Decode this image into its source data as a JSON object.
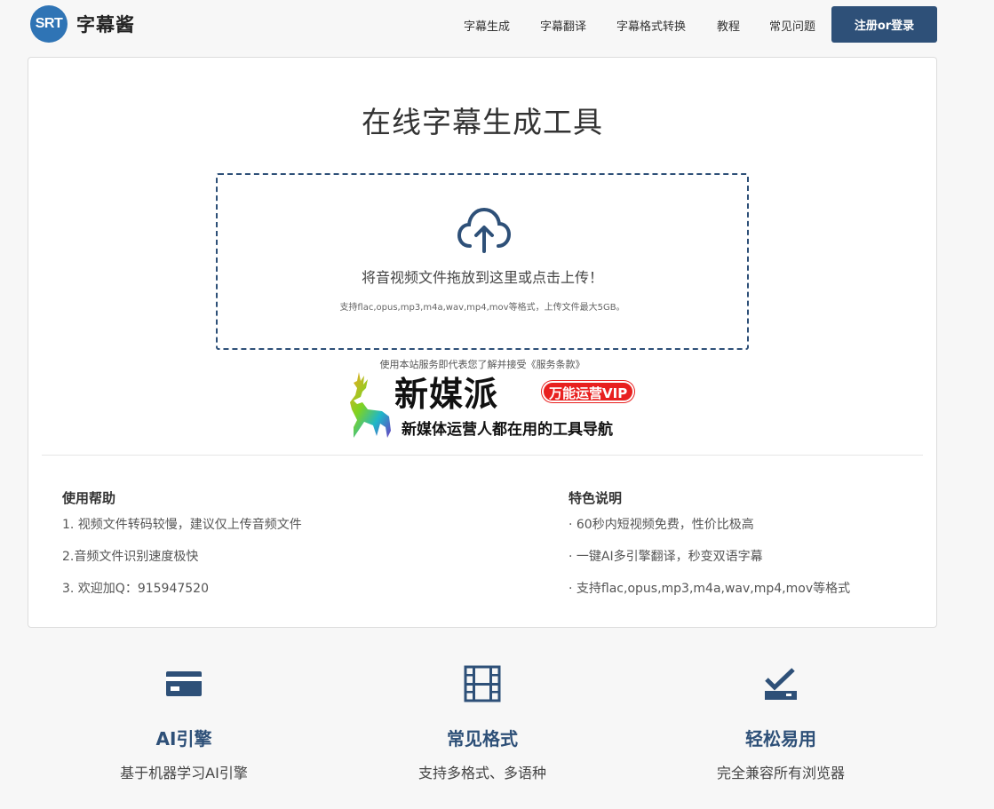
{
  "header": {
    "logo_badge": "SRT",
    "logo_name": "字幕酱",
    "nav": [
      {
        "label": "字幕生成"
      },
      {
        "label": "字幕翻译"
      },
      {
        "label": "字幕格式转换"
      },
      {
        "label": "教程"
      },
      {
        "label": "常见问题"
      }
    ],
    "login_label": "注册or登录"
  },
  "main": {
    "title": "在线字幕生成工具",
    "upload": {
      "icon": "cloud-upload-icon",
      "main_text": "将音视频文件拖放到这里或点击上传！",
      "sub_text": "支持flac,opus,mp3,m4a,wav,mp4,mov等格式，上传文件最大5GB。"
    },
    "terms_prefix": "使用本站服务即代表您了解并接受",
    "terms_link": "《服务条款》",
    "banner": {
      "icon": "deer-logo-icon",
      "title": "新媒派",
      "badge": "万能运营VIP",
      "subtitle": "新媒体运营人都在用的工具导航"
    },
    "help": {
      "heading": "使用帮助",
      "items": [
        "1. 视频文件转码较慢，建议仅上传音频文件",
        "2.音频文件识别速度极快",
        "3. 欢迎加Q：915947520"
      ]
    },
    "features_info": {
      "heading": "特色说明",
      "items": [
        "· 60秒内短视频免费，性价比极高",
        "· 一键AI多引擎翻译，秒变双语字幕",
        "· 支持flac,opus,mp3,m4a,wav,mp4,mov等格式"
      ]
    }
  },
  "features": [
    {
      "icon": "credit-card-icon",
      "title": "AI引擎",
      "desc": "基于机器学习AI引擎"
    },
    {
      "icon": "film-icon",
      "title": "常见格式",
      "desc": "支持多格式、多语种"
    },
    {
      "icon": "checkbox-tray-icon",
      "title": "轻松易用",
      "desc": "完全兼容所有浏览器"
    }
  ],
  "colors": {
    "brand": "#2e5078",
    "logo": "#2f74b5",
    "badge_red": "#e8201f"
  }
}
